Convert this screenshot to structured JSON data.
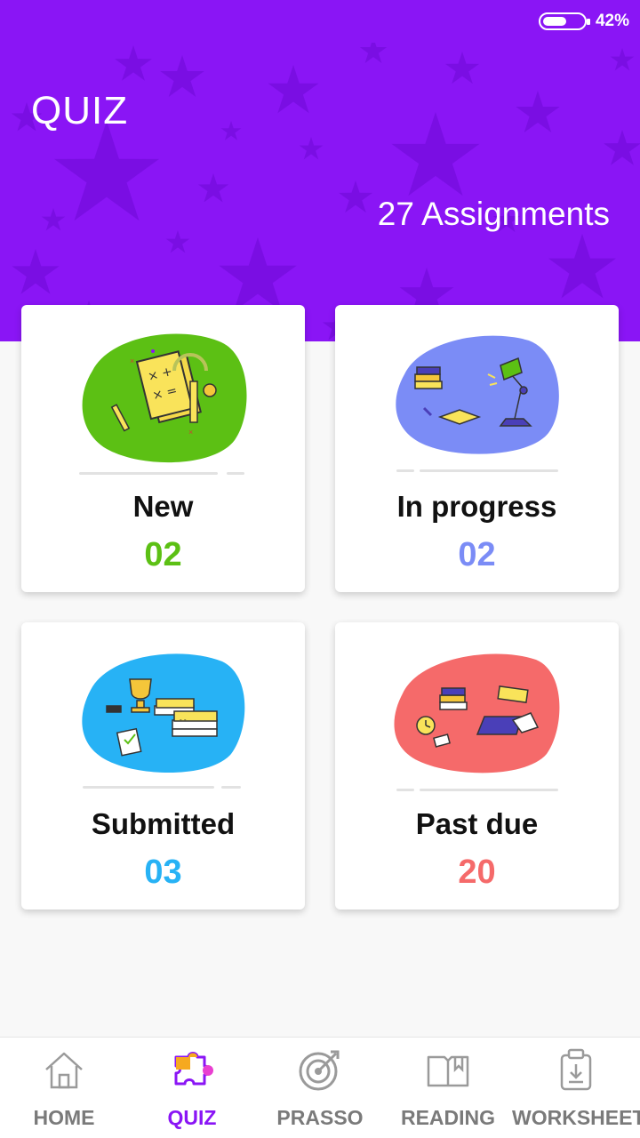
{
  "status_bar": {
    "battery_percent": 42,
    "battery_text": "42%"
  },
  "header": {
    "title": "QUIZ",
    "assignments": "27 Assignments"
  },
  "colors": {
    "brand": "#8a15f5",
    "new": "#5cc014",
    "in_progress": "#7b8cf6",
    "submitted": "#27b2f5",
    "past_due": "#f56a6a"
  },
  "cards": [
    {
      "label": "New",
      "count": "02",
      "icon": "math-notebook-illustration"
    },
    {
      "label": "In progress",
      "count": "02",
      "icon": "books-lamp-illustration"
    },
    {
      "label": "Submitted",
      "count": "03",
      "icon": "trophy-books-illustration"
    },
    {
      "label": "Past due",
      "count": "20",
      "icon": "clock-books-illustration"
    }
  ],
  "nav": [
    {
      "label": "HOME",
      "icon": "home-icon",
      "active": false
    },
    {
      "label": "QUIZ",
      "icon": "puzzle-icon",
      "active": true
    },
    {
      "label": "PRASSO",
      "icon": "target-icon",
      "active": false
    },
    {
      "label": "READING",
      "icon": "book-icon",
      "active": false
    },
    {
      "label": "WORKSHEET",
      "icon": "clipboard-download-icon",
      "active": false
    }
  ]
}
